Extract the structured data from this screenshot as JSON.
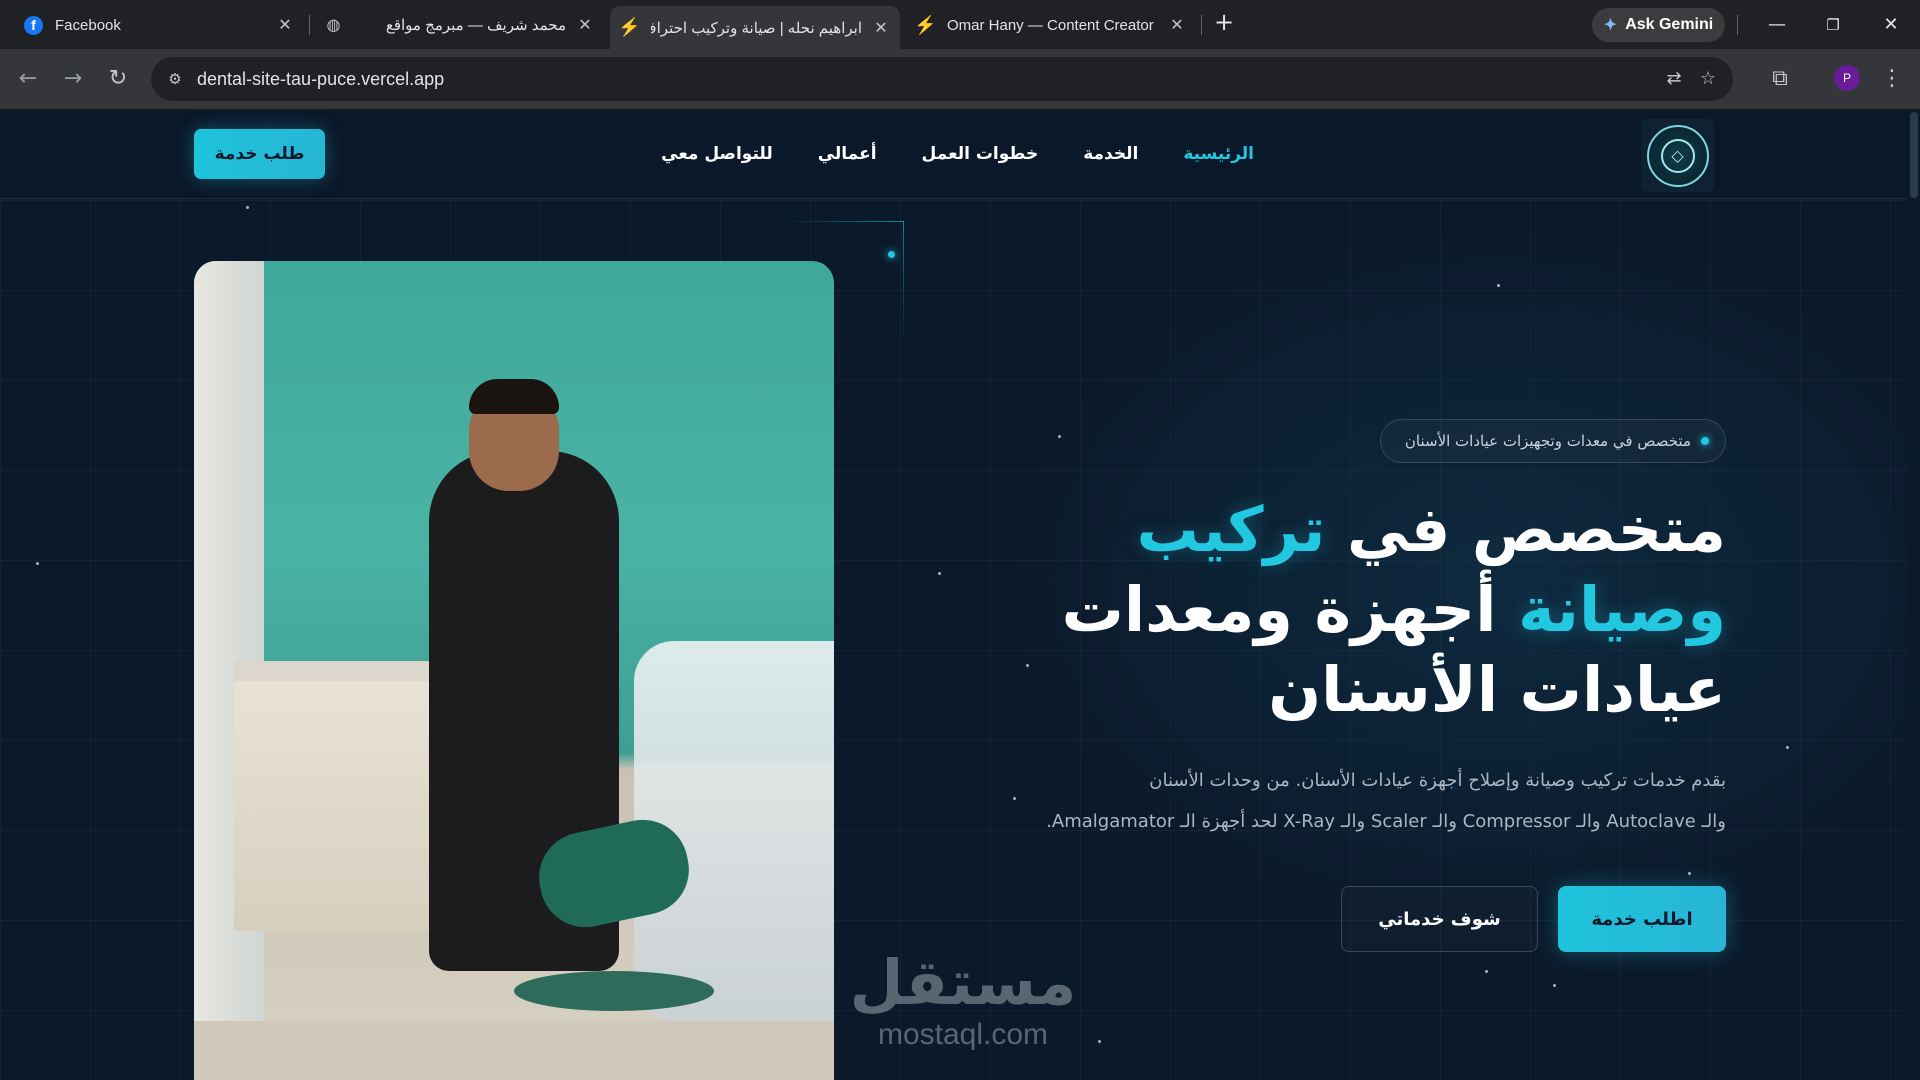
{
  "browser": {
    "tabs": [
      {
        "title": "Facebook",
        "icon": "facebook-icon",
        "color": "#1877f2"
      },
      {
        "title": "محمد شريف — مبرمج مواقع",
        "icon": "globe-icon"
      },
      {
        "title": "ابراهيم نحله | صيانة وتركيب احتراف",
        "icon": "vercel-bolt-icon",
        "active": true
      },
      {
        "title": "Omar Hany — Content Creator",
        "icon": "vercel-bolt-icon"
      }
    ],
    "ask_gemini": "Ask Gemini",
    "url": "dental-site-tau-puce.vercel.app",
    "profile_initial": "P"
  },
  "site": {
    "nav": {
      "items": [
        "الرئيسية",
        "الخدمة",
        "خطوات العمل",
        "أعمالي",
        "للتواصل معي"
      ],
      "active_index": 0,
      "cta": "طلب خدمة"
    },
    "hero": {
      "badge": "متخصص في معدات وتجهيزات عيادات الأسنان",
      "headline": {
        "line1_plain": "متخصص في ",
        "line1_accent": "تركيب",
        "line2_accent": "وصيانة",
        "line2_plain": " أجهزة ومعدات",
        "line3": "عيادات الأسنان"
      },
      "description": {
        "line1": "بقدم خدمات تركيب وصيانة وإصلاح أجهزة عيادات الأسنان. من وحدات الأسنان",
        "line2": "والـ Autoclave والـ Compressor والـ Scaler والـ X-Ray لحد أجهزة الـ Amalgamator."
      },
      "primary_button": "اطلب خدمة",
      "secondary_button": "شوف خدماتي"
    },
    "watermark": {
      "ar": "مستقل",
      "en": "mostaql.com"
    },
    "colors": {
      "accent": "#22c7e0",
      "background": "#0b1a2b"
    }
  }
}
